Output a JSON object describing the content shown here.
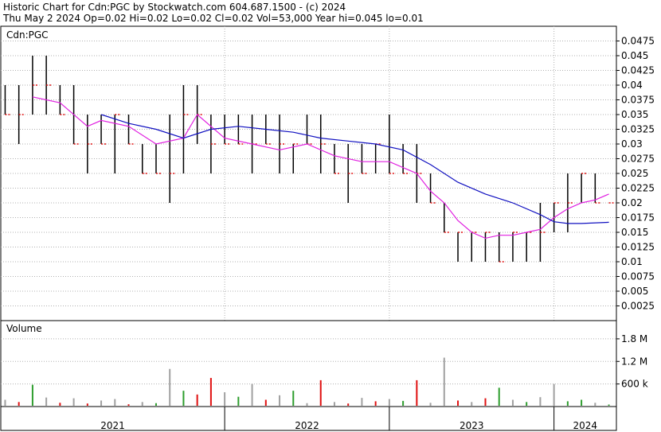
{
  "header": {
    "line1": "Historic Chart for Cdn:PGC by Stockwatch.com 604.687.1500 - (c) 2024",
    "line2": "Thu May  2 2024  Op=0.02  Hi=0.02  Lo=0.02  Cl=0.02  Vol=53,000  Year hi=0.045  lo=0.01"
  },
  "colors": {
    "up": "#2e9e2e",
    "down": "#e01010",
    "neutral": "#a0a0a0",
    "flat_close": "#e01010",
    "ma_short": "#e020e0",
    "ma_long": "#1010c0",
    "grid": "#b0b0b0",
    "frame": "#000000"
  },
  "chart_data": [
    {
      "type": "line",
      "title": "Cdn:PGC",
      "ylim": [
        0,
        0.05
      ],
      "y_ticks": [
        "0.0475",
        "0.045",
        "0.0425",
        "0.04",
        "0.0375",
        "0.035",
        "0.0325",
        "0.03",
        "0.0275",
        "0.025",
        "0.0225",
        "0.02",
        "0.0175",
        "0.015",
        "0.0125",
        "0.01",
        "0.0075",
        "0.005",
        "0.0025"
      ],
      "x_labels": [
        "2021",
        "2022",
        "2023",
        "2024"
      ],
      "grid": true,
      "series": [
        {
          "name": "",
          "kind": "ohlc_bars",
          "points": [
            {
              "x": "2020-09",
              "hi": 0.04,
              "lo": 0.035,
              "cl": 0.035
            },
            {
              "x": "2020-10",
              "hi": 0.04,
              "lo": 0.03,
              "cl": 0.035
            },
            {
              "x": "2020-11",
              "hi": 0.045,
              "lo": 0.035,
              "cl": 0.04
            },
            {
              "x": "2020-12",
              "hi": 0.045,
              "lo": 0.035,
              "cl": 0.04
            },
            {
              "x": "2021-01",
              "hi": 0.04,
              "lo": 0.035,
              "cl": 0.035
            },
            {
              "x": "2021-02",
              "hi": 0.04,
              "lo": 0.03,
              "cl": 0.03
            },
            {
              "x": "2021-03",
              "hi": 0.035,
              "lo": 0.025,
              "cl": 0.03
            },
            {
              "x": "2021-04",
              "hi": 0.035,
              "lo": 0.03,
              "cl": 0.03
            },
            {
              "x": "2021-05",
              "hi": 0.035,
              "lo": 0.025,
              "cl": 0.035
            },
            {
              "x": "2021-06",
              "hi": 0.035,
              "lo": 0.03,
              "cl": 0.03
            },
            {
              "x": "2021-07",
              "hi": 0.03,
              "lo": 0.025,
              "cl": 0.025
            },
            {
              "x": "2021-08",
              "hi": 0.03,
              "lo": 0.025,
              "cl": 0.025
            },
            {
              "x": "2021-09",
              "hi": 0.035,
              "lo": 0.02,
              "cl": 0.025
            },
            {
              "x": "2021-10",
              "hi": 0.04,
              "lo": 0.025,
              "cl": 0.035
            },
            {
              "x": "2021-11",
              "hi": 0.04,
              "lo": 0.03,
              "cl": 0.035
            },
            {
              "x": "2021-12",
              "hi": 0.035,
              "lo": 0.025,
              "cl": 0.03
            },
            {
              "x": "2022-01",
              "hi": 0.035,
              "lo": 0.03,
              "cl": 0.03
            },
            {
              "x": "2022-02",
              "hi": 0.035,
              "lo": 0.03,
              "cl": 0.03
            },
            {
              "x": "2022-03",
              "hi": 0.035,
              "lo": 0.025,
              "cl": 0.03
            },
            {
              "x": "2022-04",
              "hi": 0.035,
              "lo": 0.03,
              "cl": 0.03
            },
            {
              "x": "2022-05",
              "hi": 0.035,
              "lo": 0.025,
              "cl": 0.03
            },
            {
              "x": "2022-06",
              "hi": 0.03,
              "lo": 0.025,
              "cl": 0.03
            },
            {
              "x": "2022-07",
              "hi": 0.035,
              "lo": 0.03,
              "cl": 0.03
            },
            {
              "x": "2022-08",
              "hi": 0.035,
              "lo": 0.025,
              "cl": 0.03
            },
            {
              "x": "2022-09",
              "hi": 0.03,
              "lo": 0.025,
              "cl": 0.025
            },
            {
              "x": "2022-10",
              "hi": 0.03,
              "lo": 0.02,
              "cl": 0.025
            },
            {
              "x": "2022-11",
              "hi": 0.03,
              "lo": 0.025,
              "cl": 0.025
            },
            {
              "x": "2022-12",
              "hi": 0.03,
              "lo": 0.025,
              "cl": 0.03
            },
            {
              "x": "2023-01",
              "hi": 0.035,
              "lo": 0.025,
              "cl": 0.025
            },
            {
              "x": "2023-02",
              "hi": 0.03,
              "lo": 0.025,
              "cl": 0.025
            },
            {
              "x": "2023-03",
              "hi": 0.03,
              "lo": 0.02,
              "cl": 0.025
            },
            {
              "x": "2023-04",
              "hi": 0.025,
              "lo": 0.02,
              "cl": 0.02
            },
            {
              "x": "2023-05",
              "hi": 0.02,
              "lo": 0.015,
              "cl": 0.015
            },
            {
              "x": "2023-06",
              "hi": 0.015,
              "lo": 0.01,
              "cl": 0.015
            },
            {
              "x": "2023-07",
              "hi": 0.015,
              "lo": 0.01,
              "cl": 0.015
            },
            {
              "x": "2023-08",
              "hi": 0.015,
              "lo": 0.01,
              "cl": 0.015
            },
            {
              "x": "2023-09",
              "hi": 0.015,
              "lo": 0.01,
              "cl": 0.01
            },
            {
              "x": "2023-10",
              "hi": 0.015,
              "lo": 0.01,
              "cl": 0.015
            },
            {
              "x": "2023-11",
              "hi": 0.015,
              "lo": 0.01,
              "cl": 0.015
            },
            {
              "x": "2023-12",
              "hi": 0.02,
              "lo": 0.01,
              "cl": 0.015
            },
            {
              "x": "2024-01",
              "hi": 0.02,
              "lo": 0.015,
              "cl": 0.02
            },
            {
              "x": "2024-02",
              "hi": 0.025,
              "lo": 0.015,
              "cl": 0.02
            },
            {
              "x": "2024-03",
              "hi": 0.025,
              "lo": 0.02,
              "cl": 0.025
            },
            {
              "x": "2024-04",
              "hi": 0.025,
              "lo": 0.02,
              "cl": 0.02
            },
            {
              "x": "2024-05",
              "hi": 0.02,
              "lo": 0.02,
              "cl": 0.02
            }
          ]
        },
        {
          "name": "",
          "kind": "moving_average_short",
          "points": [
            [
              "2020-11",
              0.038
            ],
            [
              "2021-01",
              0.037
            ],
            [
              "2021-03",
              0.033
            ],
            [
              "2021-04",
              0.034
            ],
            [
              "2021-06",
              0.033
            ],
            [
              "2021-08",
              0.03
            ],
            [
              "2021-10",
              0.031
            ],
            [
              "2021-11",
              0.035
            ],
            [
              "2021-12",
              0.033
            ],
            [
              "2022-01",
              0.031
            ],
            [
              "2022-03",
              0.03
            ],
            [
              "2022-05",
              0.029
            ],
            [
              "2022-07",
              0.03
            ],
            [
              "2022-09",
              0.028
            ],
            [
              "2022-11",
              0.027
            ],
            [
              "2023-01",
              0.027
            ],
            [
              "2023-03",
              0.025
            ],
            [
              "2023-04",
              0.022
            ],
            [
              "2023-05",
              0.02
            ],
            [
              "2023-06",
              0.017
            ],
            [
              "2023-07",
              0.015
            ],
            [
              "2023-08",
              0.014
            ],
            [
              "2023-09",
              0.0145
            ],
            [
              "2023-10",
              0.0145
            ],
            [
              "2023-11",
              0.015
            ],
            [
              "2023-12",
              0.0155
            ],
            [
              "2024-01",
              0.0175
            ],
            [
              "2024-02",
              0.019
            ],
            [
              "2024-03",
              0.02
            ],
            [
              "2024-04",
              0.0205
            ],
            [
              "2024-05",
              0.0215
            ]
          ]
        },
        {
          "name": "",
          "kind": "moving_average_long",
          "points": [
            [
              "2021-04",
              0.035
            ],
            [
              "2021-06",
              0.0335
            ],
            [
              "2021-08",
              0.0325
            ],
            [
              "2021-10",
              0.031
            ],
            [
              "2021-12",
              0.0325
            ],
            [
              "2022-02",
              0.033
            ],
            [
              "2022-04",
              0.0325
            ],
            [
              "2022-06",
              0.032
            ],
            [
              "2022-08",
              0.031
            ],
            [
              "2022-10",
              0.0305
            ],
            [
              "2022-12",
              0.03
            ],
            [
              "2023-02",
              0.029
            ],
            [
              "2023-04",
              0.0265
            ],
            [
              "2023-06",
              0.0235
            ],
            [
              "2023-08",
              0.0215
            ],
            [
              "2023-10",
              0.02
            ],
            [
              "2023-12",
              0.018
            ],
            [
              "2024-01",
              0.0168
            ],
            [
              "2024-02",
              0.0165
            ],
            [
              "2024-03",
              0.0165
            ],
            [
              "2024-05",
              0.0167
            ]
          ]
        }
      ]
    },
    {
      "type": "bar",
      "title": "Volume",
      "ylim": [
        0,
        2200000
      ],
      "y_ticks": [
        "1.8 M",
        "1.2 M",
        "600 k"
      ],
      "series": [
        {
          "name": "",
          "points": [
            {
              "x": "2020-09",
              "v": 180000,
              "c": "neutral"
            },
            {
              "x": "2020-10",
              "v": 120000,
              "c": "down"
            },
            {
              "x": "2020-11",
              "v": 580000,
              "c": "up"
            },
            {
              "x": "2020-12",
              "v": 240000,
              "c": "neutral"
            },
            {
              "x": "2021-01",
              "v": 100000,
              "c": "down"
            },
            {
              "x": "2021-02",
              "v": 220000,
              "c": "neutral"
            },
            {
              "x": "2021-03",
              "v": 80000,
              "c": "down"
            },
            {
              "x": "2021-04",
              "v": 160000,
              "c": "neutral"
            },
            {
              "x": "2021-05",
              "v": 200000,
              "c": "neutral"
            },
            {
              "x": "2021-06",
              "v": 60000,
              "c": "down"
            },
            {
              "x": "2021-07",
              "v": 120000,
              "c": "neutral"
            },
            {
              "x": "2021-08",
              "v": 90000,
              "c": "up"
            },
            {
              "x": "2021-09",
              "v": 1000000,
              "c": "neutral"
            },
            {
              "x": "2021-10",
              "v": 420000,
              "c": "up"
            },
            {
              "x": "2021-11",
              "v": 320000,
              "c": "down"
            },
            {
              "x": "2021-12",
              "v": 760000,
              "c": "down"
            },
            {
              "x": "2022-01",
              "v": 380000,
              "c": "neutral"
            },
            {
              "x": "2022-02",
              "v": 260000,
              "c": "up"
            },
            {
              "x": "2022-03",
              "v": 600000,
              "c": "neutral"
            },
            {
              "x": "2022-04",
              "v": 180000,
              "c": "down"
            },
            {
              "x": "2022-05",
              "v": 300000,
              "c": "neutral"
            },
            {
              "x": "2022-06",
              "v": 420000,
              "c": "up"
            },
            {
              "x": "2022-07",
              "v": 90000,
              "c": "neutral"
            },
            {
              "x": "2022-08",
              "v": 700000,
              "c": "down"
            },
            {
              "x": "2022-09",
              "v": 120000,
              "c": "neutral"
            },
            {
              "x": "2022-10",
              "v": 80000,
              "c": "down"
            },
            {
              "x": "2022-11",
              "v": 230000,
              "c": "neutral"
            },
            {
              "x": "2022-12",
              "v": 140000,
              "c": "down"
            },
            {
              "x": "2023-01",
              "v": 200000,
              "c": "neutral"
            },
            {
              "x": "2023-02",
              "v": 150000,
              "c": "up"
            },
            {
              "x": "2023-03",
              "v": 700000,
              "c": "down"
            },
            {
              "x": "2023-04",
              "v": 100000,
              "c": "neutral"
            },
            {
              "x": "2023-05",
              "v": 1300000,
              "c": "neutral"
            },
            {
              "x": "2023-06",
              "v": 160000,
              "c": "down"
            },
            {
              "x": "2023-07",
              "v": 120000,
              "c": "neutral"
            },
            {
              "x": "2023-08",
              "v": 220000,
              "c": "down"
            },
            {
              "x": "2023-09",
              "v": 500000,
              "c": "up"
            },
            {
              "x": "2023-10",
              "v": 180000,
              "c": "neutral"
            },
            {
              "x": "2023-11",
              "v": 120000,
              "c": "up"
            },
            {
              "x": "2023-12",
              "v": 250000,
              "c": "neutral"
            },
            {
              "x": "2024-01",
              "v": 600000,
              "c": "neutral"
            },
            {
              "x": "2024-02",
              "v": 140000,
              "c": "up"
            },
            {
              "x": "2024-03",
              "v": 180000,
              "c": "up"
            },
            {
              "x": "2024-04",
              "v": 100000,
              "c": "neutral"
            },
            {
              "x": "2024-05",
              "v": 53000,
              "c": "up"
            }
          ]
        }
      ]
    }
  ]
}
